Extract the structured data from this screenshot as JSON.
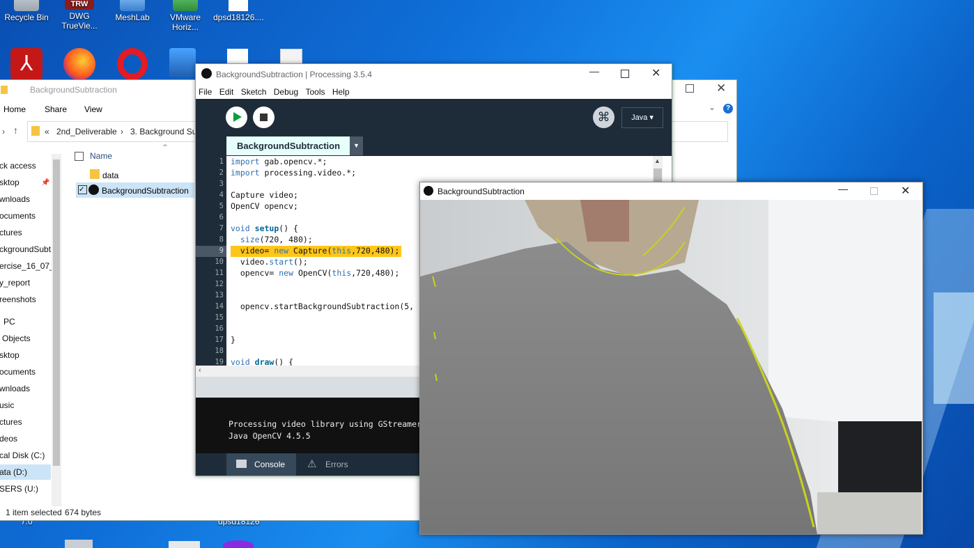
{
  "desktop": {
    "icons": [
      {
        "label": "Recycle Bin"
      },
      {
        "label": "DWG TrueVie..."
      },
      {
        "label": "MeshLab"
      },
      {
        "label": "VMware Horiz..."
      },
      {
        "label": "dpsd18126...."
      }
    ],
    "bottom_labels": {
      "left": "7.0",
      "right": "dpsd18126"
    },
    "trw_badge": "TRW"
  },
  "explorer": {
    "title": "BackgroundSubtraction",
    "ribbon_tabs": [
      "Home",
      "Share",
      "View"
    ],
    "breadcrumb": [
      "«",
      "2nd_Deliverable",
      "›",
      "3. Background Sub"
    ],
    "nav_items": [
      "ck access",
      "sktop",
      "wnloads",
      "ocuments",
      "ctures",
      "ckgroundSubt",
      "ercise_16_07_t",
      "y_report",
      "reenshots",
      "PC",
      "Objects",
      "sktop",
      "ocuments",
      "wnloads",
      "usic",
      "ctures",
      "deos",
      "cal Disk (C:)",
      "ata (D:)",
      "SERS (U:)"
    ],
    "column_header": "Name",
    "files": [
      {
        "name": "data",
        "type": "folder"
      },
      {
        "name": "BackgroundSubtraction",
        "type": "pde"
      }
    ],
    "status": {
      "selected": "1 item selected",
      "size": "674 bytes"
    }
  },
  "processing": {
    "title": "BackgroundSubtraction | Processing 3.5.4",
    "menu": [
      "File",
      "Edit",
      "Sketch",
      "Debug",
      "Tools",
      "Help"
    ],
    "mode": "Java ▾",
    "tab": "BackgroundSubtraction",
    "code_lines": [
      {
        "n": "1",
        "text": "import gab.opencv.*;"
      },
      {
        "n": "2",
        "text": "import processing.video.*;"
      },
      {
        "n": "3",
        "text": ""
      },
      {
        "n": "4",
        "text": "Capture video;"
      },
      {
        "n": "5",
        "text": "OpenCV opencv;"
      },
      {
        "n": "6",
        "text": ""
      },
      {
        "n": "7",
        "text": "void setup() {"
      },
      {
        "n": "8",
        "text": "  size(720, 480);"
      },
      {
        "n": "9",
        "text": "  video= new Capture(this,720,480);"
      },
      {
        "n": "10",
        "text": "  video.start();"
      },
      {
        "n": "11",
        "text": "  opencv= new OpenCV(this,720,480);"
      },
      {
        "n": "12",
        "text": ""
      },
      {
        "n": "13",
        "text": ""
      },
      {
        "n": "14",
        "text": "  opencv.startBackgroundSubtraction(5,"
      },
      {
        "n": "15",
        "text": ""
      },
      {
        "n": "16",
        "text": ""
      },
      {
        "n": "17",
        "text": "}"
      },
      {
        "n": "18",
        "text": ""
      },
      {
        "n": "19",
        "text": "void draw() {"
      }
    ],
    "highlight_line": 9,
    "console_lines": [
      "Processing video library using GStreamer",
      "Java OpenCV 4.5.5"
    ],
    "bottom_tabs": {
      "console": "Console",
      "errors": "Errors"
    }
  },
  "sketch": {
    "title": "BackgroundSubtraction"
  },
  "colors": {
    "processing_dark": "#1e2c3a",
    "tab_bg": "#e6fffb",
    "highlight": "#ffc61a",
    "edge": "#c8d21e"
  }
}
